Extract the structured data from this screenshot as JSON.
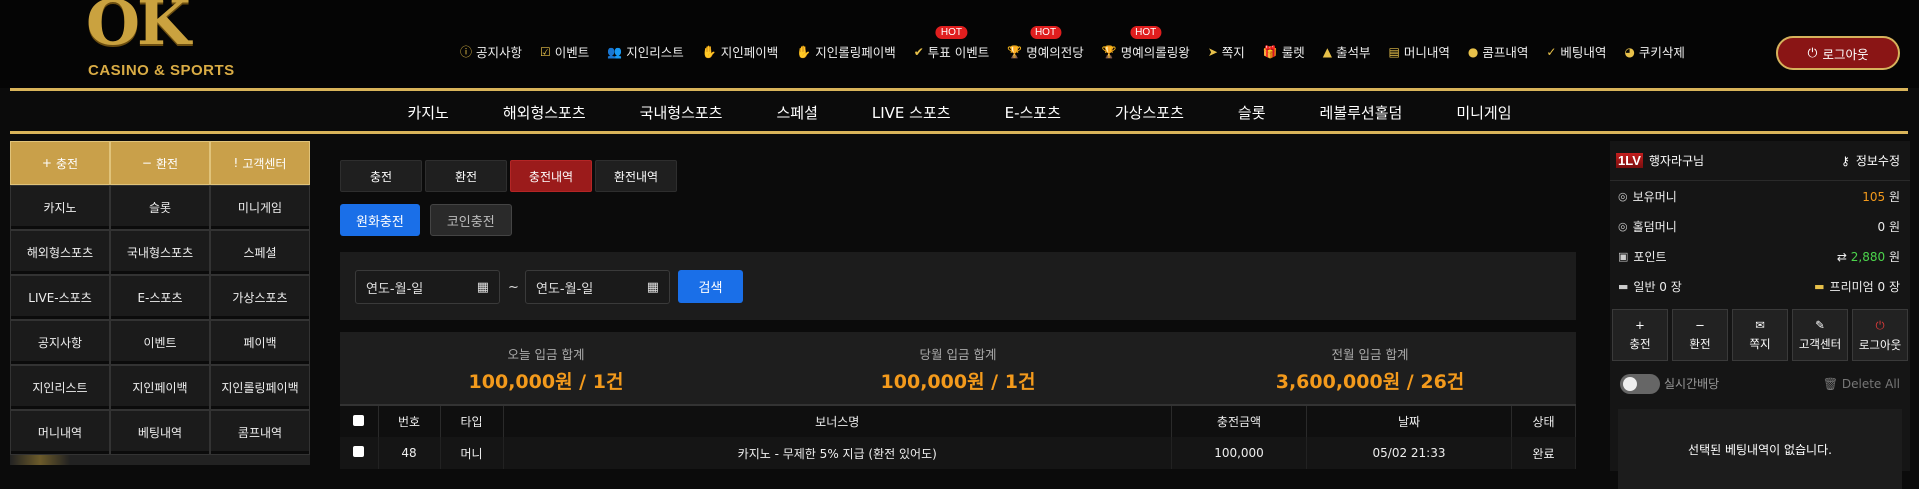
{
  "logo": {
    "mark": "OK",
    "sub": "CASINO & SPORTS"
  },
  "topnav": [
    {
      "icon": "info-icon",
      "label": "공지사항",
      "hot": ""
    },
    {
      "icon": "calendar-check-icon",
      "label": "이벤트",
      "hot": ""
    },
    {
      "icon": "users-icon",
      "label": "지인리스트",
      "hot": ""
    },
    {
      "icon": "hand-coin-icon",
      "label": "지인페이백",
      "hot": ""
    },
    {
      "icon": "hand-coin-icon",
      "label": "지인롤링페이백",
      "hot": ""
    },
    {
      "icon": "vote-icon",
      "label": "투표 이벤트",
      "hot": "HOT"
    },
    {
      "icon": "trophy-icon",
      "label": "명예의전당",
      "hot": "HOT"
    },
    {
      "icon": "trophy-icon",
      "label": "명예의롤링왕",
      "hot": "HOT"
    },
    {
      "icon": "send-icon",
      "label": "쪽지",
      "hot": ""
    },
    {
      "icon": "gift-icon",
      "label": "룰렛",
      "hot": ""
    },
    {
      "icon": "stamp-icon",
      "label": "출석부",
      "hot": ""
    },
    {
      "icon": "clipboard-icon",
      "label": "머니내역",
      "hot": ""
    },
    {
      "icon": "piggy-bank-icon",
      "label": "콤프내역",
      "hot": ""
    },
    {
      "icon": "check-icon",
      "label": "베팅내역",
      "hot": ""
    },
    {
      "icon": "cookie-icon",
      "label": "쿠키삭제",
      "hot": ""
    }
  ],
  "logout_top": "로그아웃",
  "mainnav": [
    "카지노",
    "해외형스포츠",
    "국내형스포츠",
    "스페셜",
    "LIVE 스포츠",
    "E-스포츠",
    "가상스포츠",
    "슬롯",
    "레볼루션홀덤",
    "미니게임"
  ],
  "left": {
    "top": [
      {
        "icon": "+",
        "label": "충전"
      },
      {
        "icon": "−",
        "label": "환전"
      },
      {
        "icon": "!",
        "label": "고객센터"
      }
    ],
    "grid": [
      "카지노",
      "슬롯",
      "미니게임",
      "해외형스포츠",
      "국내형스포츠",
      "스페셜",
      "LIVE-스포츠",
      "E-스포츠",
      "가상스포츠",
      "공지사항",
      "이벤트",
      "페이백",
      "지인리스트",
      "지인페이백",
      "지인롤링페이백",
      "머니내역",
      "베팅내역",
      "콤프내역"
    ]
  },
  "tabs": [
    "충전",
    "환전",
    "충전내역",
    "환전내역"
  ],
  "subtabs": [
    "원화충전",
    "코인충전"
  ],
  "filter": {
    "date_from": "연도-월-일",
    "date_to": "연도-월-일",
    "tilde": "~",
    "search": "검색"
  },
  "stats": [
    {
      "label": "오늘 입금 합계",
      "value": "100,000원 / 1건"
    },
    {
      "label": "당월 입금 합계",
      "value": "100,000원 / 1건"
    },
    {
      "label": "전월 입금 합계",
      "value": "3,600,000원 / 26건"
    }
  ],
  "table": {
    "headers": [
      "번호",
      "타입",
      "보너스명",
      "충전금액",
      "날짜",
      "상태"
    ],
    "rows": [
      [
        "48",
        "머니",
        "카지노 - 무제한 5% 지급 (환전 있어도)",
        "100,000",
        "05/02 21:33",
        "완료"
      ]
    ]
  },
  "right": {
    "level": "1LV",
    "username": "행자라구님",
    "edit": "정보수정",
    "balance_label": "보유머니",
    "balance_value": "105",
    "unit": "원",
    "holdem_label": "홀덤머니",
    "holdem_value": "0",
    "point_label": "포인트",
    "point_value": "2,880",
    "general": "일반 0 장",
    "premium": "프리미엄 0 장",
    "buttons": [
      {
        "icon": "+",
        "label": "충전"
      },
      {
        "icon": "−",
        "label": "환전"
      },
      {
        "icon": "✉",
        "label": "쪽지"
      },
      {
        "icon": "✎",
        "label": "고객센터"
      },
      {
        "icon": "⏻",
        "label": "로그아웃"
      }
    ],
    "realtime": "실시간배당",
    "delete_all": "Delete All",
    "empty": "선택된 베팅내역이 없습니다."
  },
  "colors": {
    "gold": "#d9b45a",
    "accent_red": "#9b1b1b",
    "blue": "#1a6fe8",
    "orange": "#f39a1c",
    "green": "#4cd44c"
  }
}
